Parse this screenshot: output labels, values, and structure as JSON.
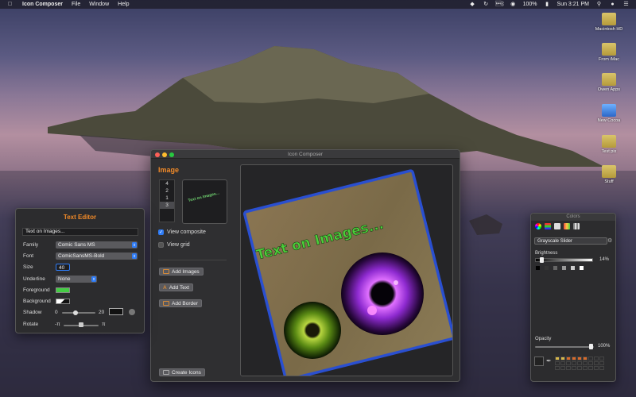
{
  "menubar": {
    "app_name": "Icon Composer",
    "menus": [
      "File",
      "Window",
      "Help"
    ],
    "battery": "100%",
    "clock": "Sun 3:21 PM"
  },
  "desktop": {
    "items": [
      {
        "label": "Macintosh HD",
        "icon": "disk-icon"
      },
      {
        "label": "From iMac",
        "icon": "drive-icon"
      },
      {
        "label": "Owen Apps",
        "icon": "folder-icon"
      },
      {
        "label": "New Cocoa",
        "icon": "app-icon"
      },
      {
        "label": "Test pix",
        "icon": "folder-icon"
      },
      {
        "label": "Stuff",
        "icon": "folder-icon"
      }
    ]
  },
  "main_window": {
    "title": "Icon Composer",
    "section_title": "Image",
    "sizes": [
      "4",
      "2",
      "1",
      "3"
    ],
    "selected_size": "3",
    "thumb_text": "Text on Images...",
    "view_composite_label": "View composite",
    "view_composite_checked": true,
    "view_grid_label": "View grid",
    "view_grid_checked": false,
    "add_images_label": "Add Images",
    "add_text_label": "Add Text",
    "add_border_label": "Add Border",
    "create_icons_label": "Create Icons",
    "canvas_text": "Text on Images...",
    "card_color": "#7a6a48",
    "border_color": "#2a4fd0"
  },
  "text_editor": {
    "title": "Text Editor",
    "text_value": "Text on Images...",
    "family_label": "Family",
    "family_value": "Comic Sans MS",
    "font_label": "Font",
    "font_value": "ComicSansMS-Bold",
    "size_label": "Size",
    "size_value": "40",
    "underline_label": "Underline",
    "underline_value": "None",
    "foreground_label": "Foreground",
    "foreground_color": "#44cc44",
    "background_label": "Background",
    "shadow_label": "Shadow",
    "shadow_min": "0",
    "shadow_max": "20",
    "rotate_label": "Rotate",
    "rotate_min": "-π",
    "rotate_max": "π"
  },
  "colors_panel": {
    "title": "Colors",
    "mode": "Grayscale Slider",
    "brightness_label": "Brightness",
    "brightness_value": "14%",
    "opacity_label": "Opacity",
    "opacity_value": "100%",
    "favorite_colors": [
      "#d8b84a",
      "#d8b84a",
      "#d96a2a",
      "#d96a2a",
      "#d96a2a",
      "#d96a2a"
    ]
  }
}
